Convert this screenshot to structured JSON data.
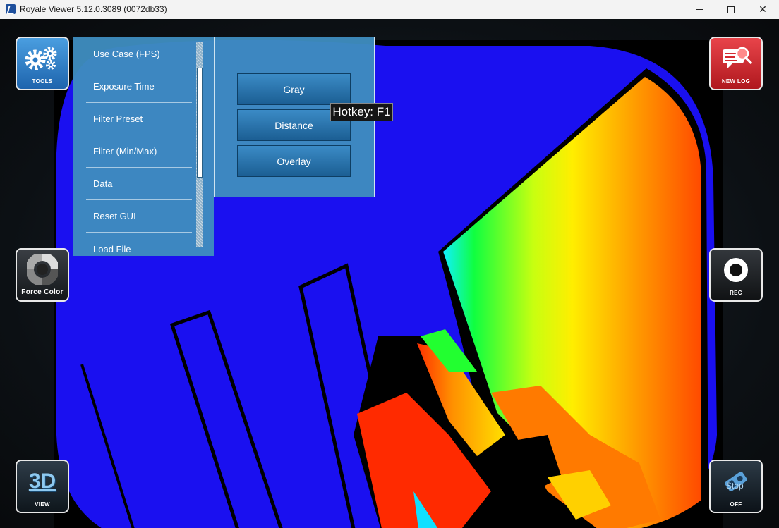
{
  "window": {
    "title": "Royale Viewer 5.12.0.3089 (0072db33)",
    "minimize_icon": "minimize-icon",
    "maximize_icon": "maximize-icon",
    "close_icon": "close-icon"
  },
  "left_buttons": {
    "tools": {
      "label": "TOOLS",
      "icon": "gears-icon"
    },
    "force_color": {
      "label": "Force Color",
      "icon": "color-wheel-icon"
    },
    "view": {
      "big": "3D",
      "label": "VIEW",
      "icon": "3d-view-icon"
    }
  },
  "right_buttons": {
    "new_log": {
      "label": "NEW LOG",
      "icon": "log-search-icon"
    },
    "rec": {
      "label": "REC",
      "icon": "record-icon"
    },
    "stop": {
      "label": "OFF",
      "overlay": "Stop",
      "icon": "camera-stop-icon"
    }
  },
  "menu": {
    "items": [
      "Use Case (FPS)",
      "Exposure Time",
      "Filter Preset",
      "Filter (Min/Max)",
      "Data",
      "Reset GUI",
      "Load File"
    ]
  },
  "submenu": {
    "buttons": [
      "Gray",
      "Distance",
      "Overlay"
    ]
  },
  "tooltip": {
    "text": "Hotkey: F1"
  },
  "colors": {
    "depth_background": "#1a10f0",
    "tools_button": "#2a7ac4",
    "new_log_button": "#d42a30",
    "menu_panel": "#3e8cbe"
  }
}
